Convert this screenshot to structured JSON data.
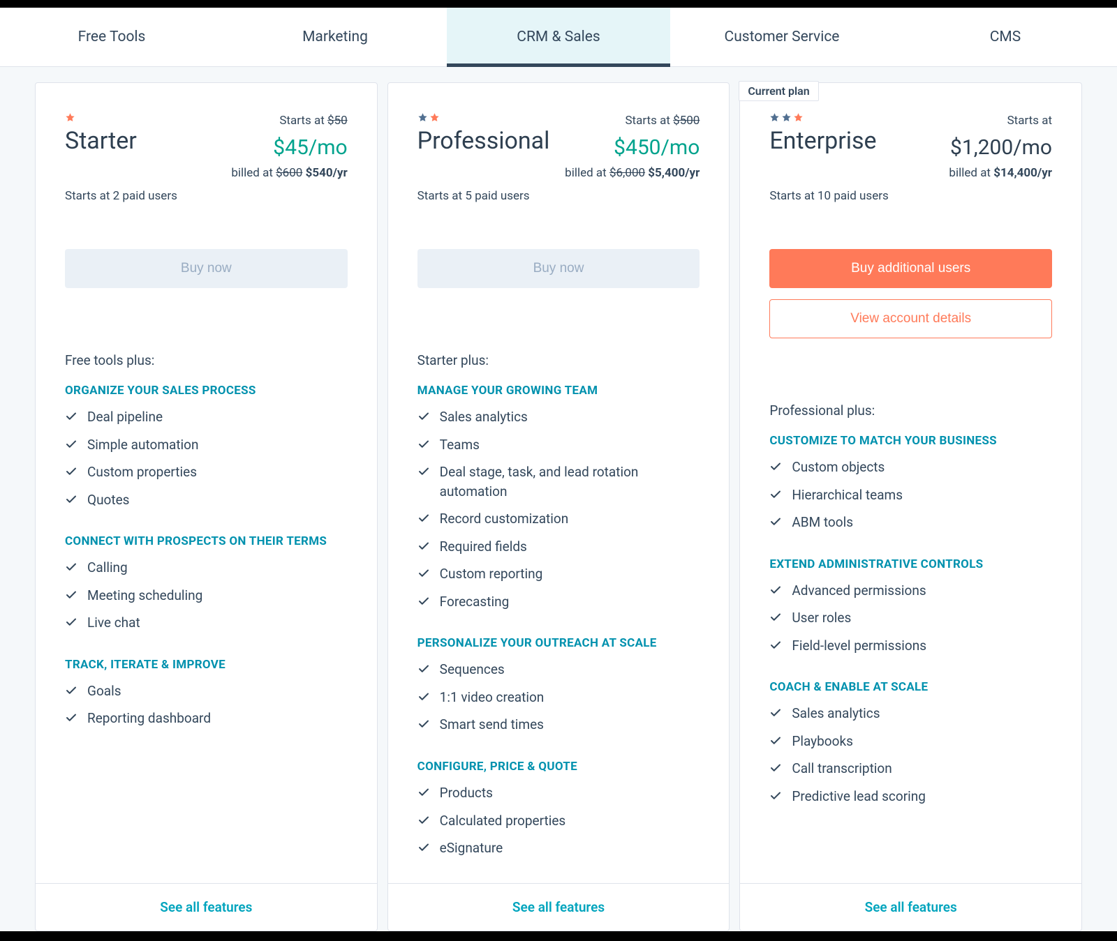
{
  "tabs": {
    "items": [
      {
        "label": "Free Tools"
      },
      {
        "label": "Marketing"
      },
      {
        "label": "CRM & Sales",
        "active": true
      },
      {
        "label": "Customer Service"
      },
      {
        "label": "CMS"
      }
    ]
  },
  "labels": {
    "see_all": "See all features",
    "current_plan": "Current plan",
    "starts_at": "Starts at",
    "billed_at": "billed at"
  },
  "plans": [
    {
      "id": "starter",
      "stars": 1,
      "title": "Starter",
      "starts_at_strike": "$50",
      "price": "$45/mo",
      "price_color": "green",
      "billed_strike": "$600",
      "billed_actual": "$540/yr",
      "paid_users": "Starts at 2 paid users",
      "ctas": [
        {
          "label": "Buy now",
          "kind": "disabled"
        }
      ],
      "plus_line": "Free tools plus:",
      "sections": [
        {
          "heading": "ORGANIZE YOUR SALES PROCESS",
          "items": [
            "Deal pipeline",
            "Simple automation",
            "Custom properties",
            "Quotes"
          ]
        },
        {
          "heading": "CONNECT WITH PROSPECTS ON THEIR TERMS",
          "items": [
            "Calling",
            "Meeting scheduling",
            "Live chat"
          ]
        },
        {
          "heading": "TRACK, ITERATE & IMPROVE",
          "items": [
            "Goals",
            "Reporting dashboard"
          ]
        }
      ]
    },
    {
      "id": "professional",
      "stars": 2,
      "title": "Professional",
      "starts_at_strike": "$500",
      "price": "$450/mo",
      "price_color": "green",
      "billed_strike": "$6,000",
      "billed_actual": "$5,400/yr",
      "paid_users": "Starts at 5 paid users",
      "ctas": [
        {
          "label": "Buy now",
          "kind": "disabled"
        }
      ],
      "plus_line": "Starter plus:",
      "sections": [
        {
          "heading": "MANAGE YOUR GROWING TEAM",
          "items": [
            "Sales analytics",
            "Teams",
            "Deal stage, task, and lead rotation automation",
            "Record customization",
            "Required fields",
            "Custom reporting",
            "Forecasting"
          ]
        },
        {
          "heading": "PERSONALIZE YOUR OUTREACH AT SCALE",
          "items": [
            "Sequences",
            "1:1 video creation",
            "Smart send times"
          ]
        },
        {
          "heading": "CONFIGURE, PRICE & QUOTE",
          "items": [
            "Products",
            "Calculated properties",
            "eSignature"
          ]
        }
      ]
    },
    {
      "id": "enterprise",
      "current": true,
      "stars": 3,
      "title": "Enterprise",
      "starts_at_strike": "",
      "price": "$1,200/mo",
      "price_color": "black",
      "billed_strike": "",
      "billed_actual": "$14,400/yr",
      "paid_users": "Starts at 10 paid users",
      "ctas": [
        {
          "label": "Buy additional users",
          "kind": "primary"
        },
        {
          "label": "View account details",
          "kind": "outline"
        }
      ],
      "plus_line": "Professional plus:",
      "sections": [
        {
          "heading": "CUSTOMIZE TO MATCH YOUR BUSINESS",
          "items": [
            "Custom objects",
            "Hierarchical teams",
            "ABM tools"
          ]
        },
        {
          "heading": "EXTEND ADMINISTRATIVE CONTROLS",
          "items": [
            "Advanced permissions",
            "User roles",
            "Field-level permissions"
          ]
        },
        {
          "heading": "COACH & ENABLE AT SCALE",
          "items": [
            "Sales analytics",
            "Playbooks",
            "Call transcription",
            "Predictive lead scoring"
          ]
        }
      ]
    }
  ]
}
